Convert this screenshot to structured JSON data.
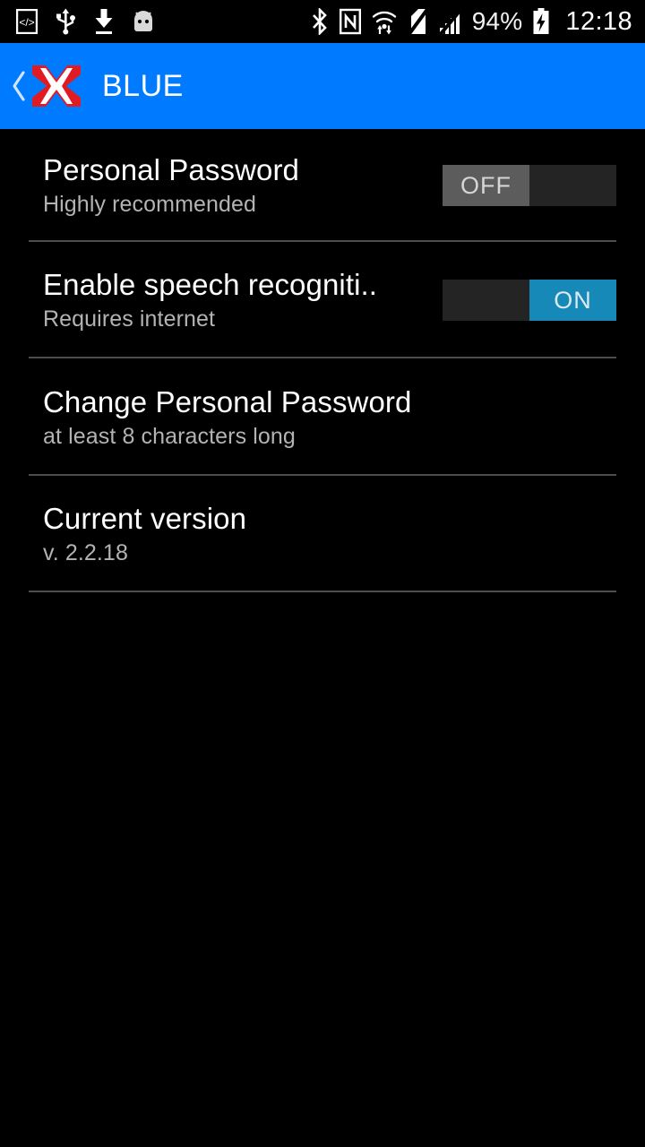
{
  "status_bar": {
    "left_icons": [
      {
        "name": "developer-code-icon",
        "glyph": "</>"
      },
      {
        "name": "usb-icon"
      },
      {
        "name": "download-icon"
      },
      {
        "name": "android-head-icon"
      }
    ],
    "right_icons": [
      {
        "name": "bluetooth-icon"
      },
      {
        "name": "nfc-icon"
      },
      {
        "name": "wifi-data-transfer-icon"
      },
      {
        "name": "no-sim-icon"
      },
      {
        "name": "signal-off-icon"
      }
    ],
    "battery_percent": "94%",
    "battery_state": "charging",
    "clock": "12:18"
  },
  "app_bar": {
    "back_label": "‹",
    "logo_name": "x-logo-icon",
    "title": "BLUE",
    "background_color": "#007bff",
    "title_color": "#ffffff"
  },
  "settings": {
    "rows": [
      {
        "id": "personal-password",
        "title": "Personal Password",
        "subtitle": "Highly recommended",
        "control": "switch",
        "switch_state": "off",
        "switch_label": "OFF"
      },
      {
        "id": "enable-speech-recognition",
        "title": "Enable speech recogniti..",
        "subtitle": "Requires internet",
        "control": "switch",
        "switch_state": "on",
        "switch_label": "ON"
      },
      {
        "id": "change-personal-password",
        "title": "Change Personal Password",
        "subtitle": "at least 8 characters long",
        "control": "none"
      },
      {
        "id": "current-version",
        "title": "Current version",
        "subtitle": "v. 2.2.18",
        "control": "none"
      }
    ]
  },
  "colors": {
    "background": "#000000",
    "accent_blue": "#007bff",
    "switch_on": "#1789b8",
    "switch_off_thumb": "#5c5c5c",
    "switch_track": "#242424",
    "divider": "#4d4d4d",
    "primary_text": "#ffffff",
    "secondary_text": "#b3b3b3"
  }
}
